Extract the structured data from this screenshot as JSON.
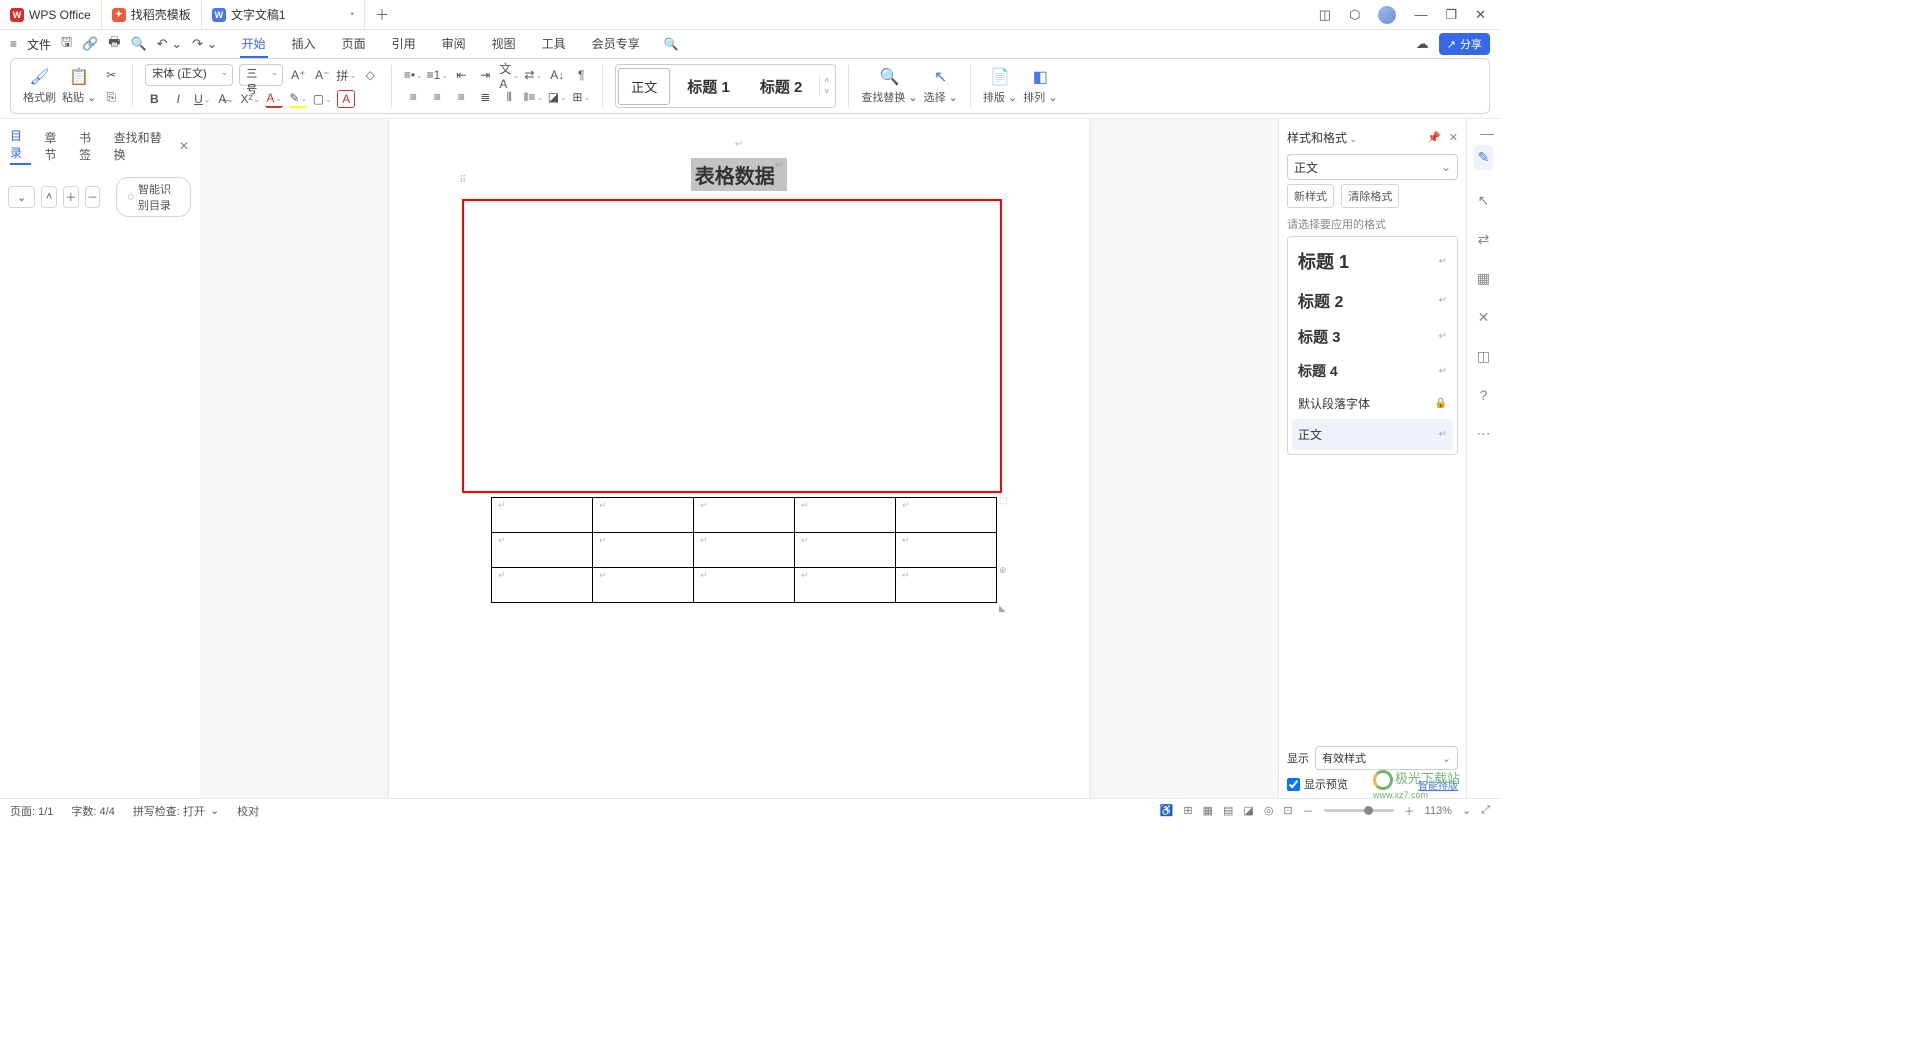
{
  "titlebar": {
    "tabs": [
      {
        "label": "WPS Office",
        "icon": "W",
        "cls": "wps"
      },
      {
        "label": "找稻壳模板",
        "icon": "",
        "cls": "template"
      },
      {
        "label": "文字文稿1",
        "icon": "W",
        "cls": "doc",
        "active": true,
        "closable": true
      }
    ]
  },
  "menu": {
    "file": "文件",
    "tabs": [
      "开始",
      "插入",
      "页面",
      "引用",
      "审阅",
      "视图",
      "工具",
      "会员专享"
    ],
    "active": "开始",
    "share": "分享"
  },
  "ribbon": {
    "format_painter": "格式刷",
    "paste": "粘贴",
    "font_name": "宋体 (正文)",
    "font_size": "三号",
    "styles": {
      "normal": "正文",
      "h1": "标题 1",
      "h2": "标题 2"
    },
    "find_replace": "查找替换",
    "select": "选择",
    "layout": "排版",
    "arrange": "排列"
  },
  "leftpanel": {
    "tabs": [
      "目录",
      "章节",
      "书签",
      "查找和替换"
    ],
    "active": "目录",
    "ai_toc": "智能识别目录"
  },
  "document": {
    "title": "表格数据"
  },
  "rightpanel": {
    "header": "样式和格式",
    "current": "正文",
    "new_style": "新样式",
    "clear_fmt": "清除格式",
    "prompt": "请选择要应用的格式",
    "styles": [
      {
        "label": "标题 1",
        "size": "18px",
        "weight": "bold"
      },
      {
        "label": "标题 2",
        "size": "16px",
        "weight": "bold"
      },
      {
        "label": "标题 3",
        "size": "15px",
        "weight": "bold"
      },
      {
        "label": "标题 4",
        "size": "14px",
        "weight": "bold"
      },
      {
        "label": "默认段落字体",
        "size": "12px",
        "weight": "normal",
        "lock": true
      },
      {
        "label": "正文",
        "size": "12px",
        "weight": "normal",
        "sel": true
      }
    ],
    "show_label": "显示",
    "show_value": "有效样式",
    "preview": "显示预览",
    "smart": "智能排版"
  },
  "status": {
    "page": "页面: 1/1",
    "words": "字数: 4/4",
    "spell": "拼写检查: 打开",
    "proof": "校对",
    "zoom": "113%"
  },
  "watermark": {
    "main": "极光下载站",
    "sub": "www.xz7.com"
  }
}
